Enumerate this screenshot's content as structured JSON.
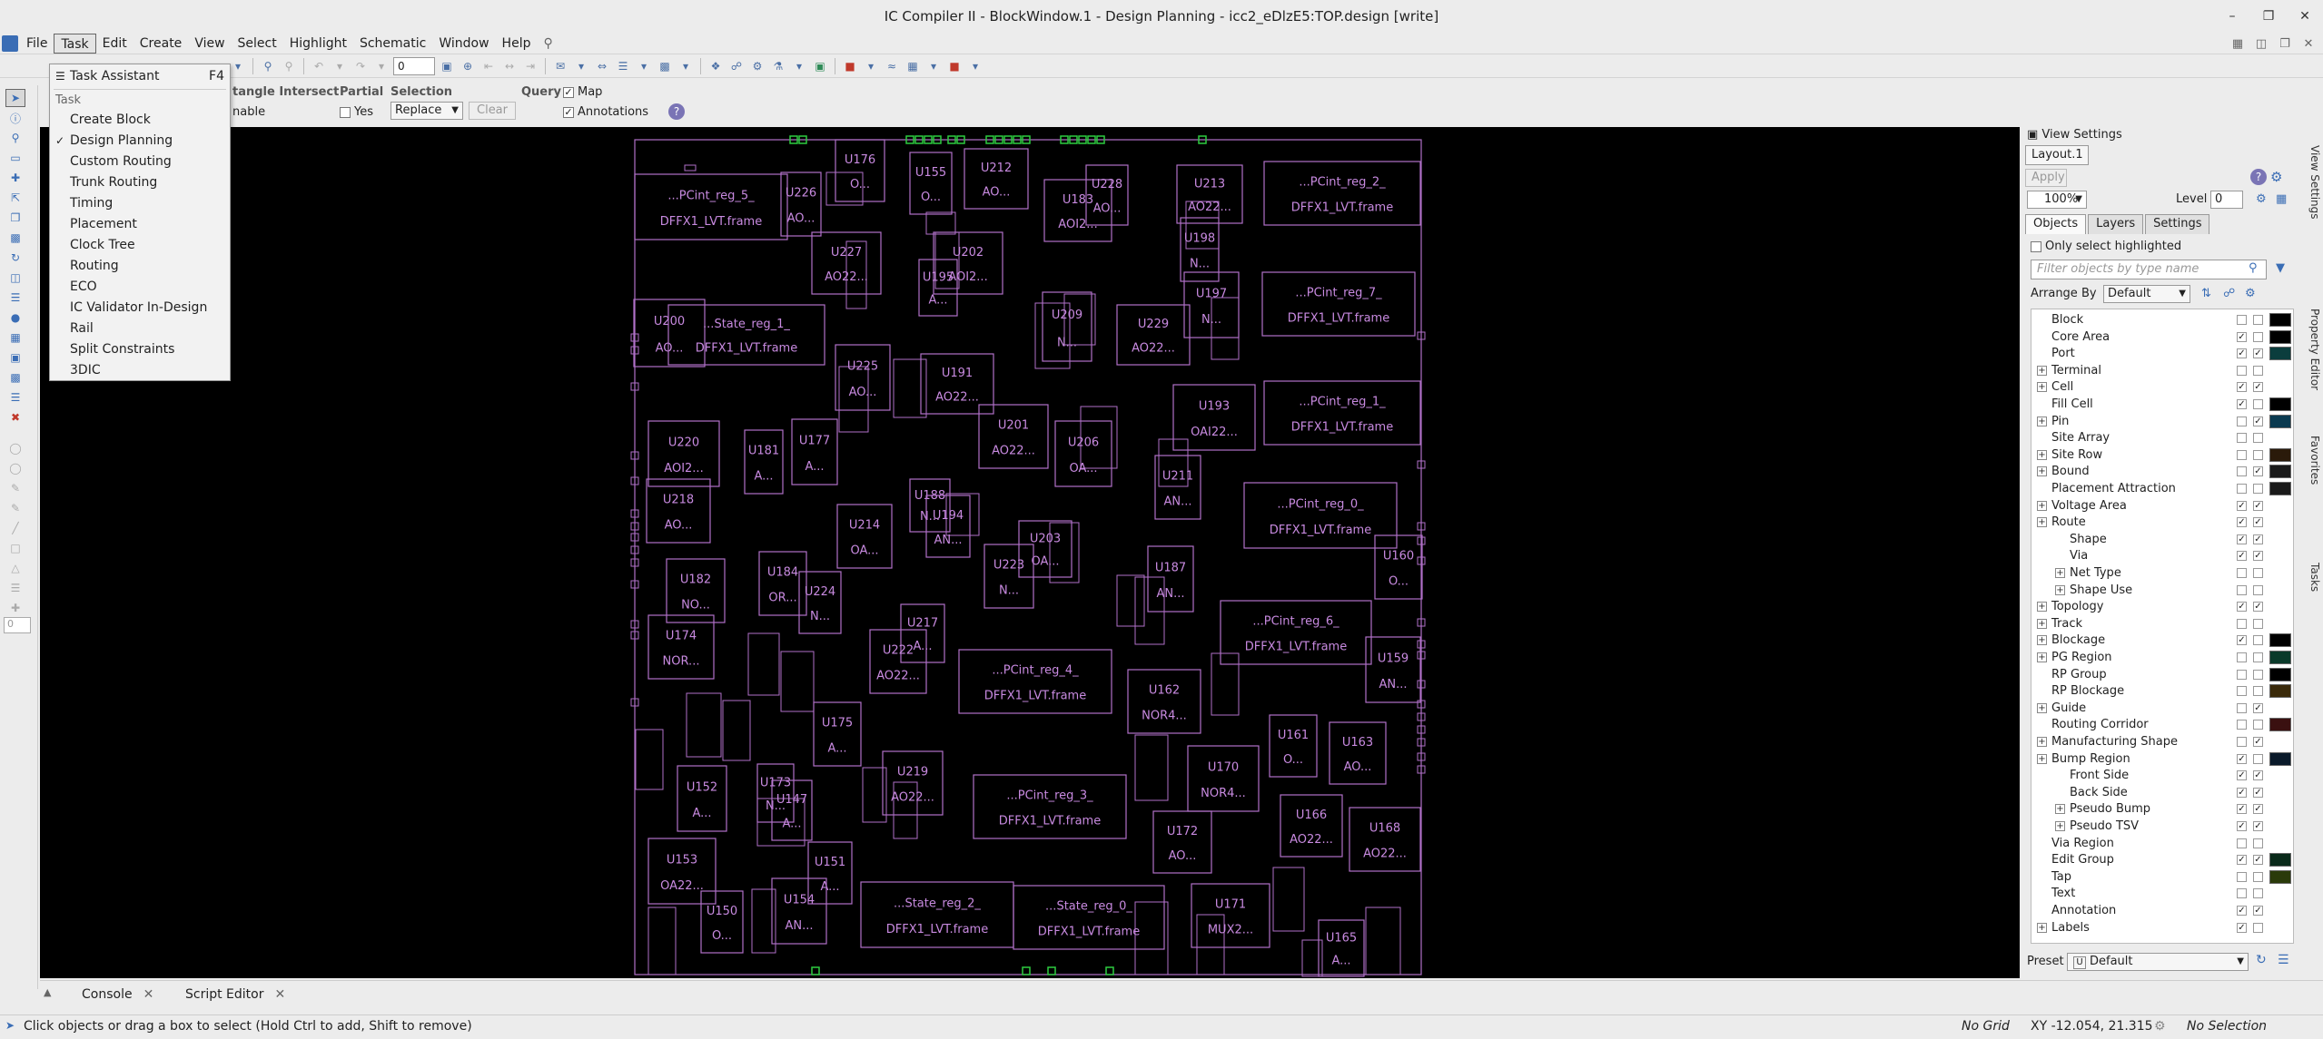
{
  "window": {
    "title": "IC Compiler II - BlockWindow.1 - Design Planning - icc2_eDlzE5:TOP.design [write]",
    "controls": [
      "–",
      "❐",
      "✕"
    ]
  },
  "menubar": {
    "items": [
      "File",
      "Task",
      "Create",
      "Edit",
      "Create",
      "View",
      "Select",
      "Highlight",
      "Schematic",
      "Window",
      "Help"
    ],
    "labels": [
      "File",
      "Task",
      "Edit",
      "Create",
      "View",
      "Select",
      "Highlight",
      "Schematic",
      "Window",
      "Help"
    ]
  },
  "toolbar": {
    "zoom_spin_value": "0"
  },
  "selection_toolbar": {
    "intersect_label": "tangle Intersect",
    "enable_label": "nable",
    "partial_label": "Partial",
    "partial_yes": "Yes",
    "selection_label": "Selection",
    "selection_mode": "Replace",
    "clear_label": "Clear",
    "query_label": "Query",
    "map_label": "Map",
    "annotations_label": "Annotations",
    "help": "?"
  },
  "task_menu": {
    "task_assistant": "Task Assistant",
    "task_assistant_shortcut": "F4",
    "section": "Task",
    "items": [
      "Create Block",
      "Design Planning",
      "Custom Routing",
      "Trunk Routing",
      "Timing",
      "Placement",
      "Clock Tree",
      "Routing",
      "ECO",
      "IC Validator In-Design",
      "Rail",
      "Split Constraints",
      "3DIC"
    ],
    "checked": "Design Planning"
  },
  "left_strip": {
    "value": "0"
  },
  "layout": {
    "cells": [
      {
        "name": "...PCint_reg_5_",
        "ref": "DFFX1_LVT.frame"
      },
      {
        "name": "U226",
        "ref": "AO..."
      },
      {
        "name": "U176",
        "ref": "O..."
      },
      {
        "name": "U155",
        "ref": "O..."
      },
      {
        "name": "U212",
        "ref": "AO..."
      },
      {
        "name": "U183",
        "ref": "AOI2..."
      },
      {
        "name": "U228",
        "ref": "AO..."
      },
      {
        "name": "U213",
        "ref": "AO22..."
      },
      {
        "name": "...PCint_reg_2_",
        "ref": "DFFX1_LVT.frame"
      },
      {
        "name": "U227",
        "ref": "AO22..."
      },
      {
        "name": "U202",
        "ref": "AOI2..."
      },
      {
        "name": "U195",
        "ref": "A..."
      },
      {
        "name": "U198",
        "ref": "N..."
      },
      {
        "name": "U197",
        "ref": "N..."
      },
      {
        "name": "...PCint_reg_7_",
        "ref": "DFFX1_LVT.frame"
      },
      {
        "name": "U200",
        "ref": "AO..."
      },
      {
        "name": "...State_reg_1_",
        "ref": "DFFX1_LVT.frame"
      },
      {
        "name": "U209",
        "ref": "N..."
      },
      {
        "name": "U229",
        "ref": "AO22..."
      },
      {
        "name": "U225",
        "ref": "AO..."
      },
      {
        "name": "U191",
        "ref": "AO22..."
      },
      {
        "name": "U193",
        "ref": "OAI22..."
      },
      {
        "name": "...PCint_reg_1_",
        "ref": "DFFX1_LVT.frame"
      },
      {
        "name": "U220",
        "ref": "AOI2..."
      },
      {
        "name": "U181",
        "ref": "A..."
      },
      {
        "name": "U177",
        "ref": "A..."
      },
      {
        "name": "U201",
        "ref": "AO22..."
      },
      {
        "name": "U206",
        "ref": "OA..."
      },
      {
        "name": "U211",
        "ref": "AN..."
      },
      {
        "name": "U218",
        "ref": "AO..."
      },
      {
        "name": "U188",
        "ref": "N..."
      },
      {
        "name": "U194",
        "ref": "AN..."
      },
      {
        "name": "U214",
        "ref": "OA..."
      },
      {
        "name": "...PCint_reg_0_",
        "ref": "DFFX1_LVT.frame"
      },
      {
        "name": "U203",
        "ref": "OA..."
      },
      {
        "name": "U223",
        "ref": "N..."
      },
      {
        "name": "U160",
        "ref": "O..."
      },
      {
        "name": "U182",
        "ref": "NO..."
      },
      {
        "name": "U184",
        "ref": "OR..."
      },
      {
        "name": "U224",
        "ref": "N..."
      },
      {
        "name": "U187",
        "ref": "AN..."
      },
      {
        "name": "U174",
        "ref": "NOR..."
      },
      {
        "name": "U217",
        "ref": "A..."
      },
      {
        "name": "U222",
        "ref": "AO22..."
      },
      {
        "name": "...PCint_reg_6_",
        "ref": "DFFX1_LVT.frame"
      },
      {
        "name": "...PCint_reg_4_",
        "ref": "DFFX1_LVT.frame"
      },
      {
        "name": "U162",
        "ref": "NOR4..."
      },
      {
        "name": "U159",
        "ref": "AN..."
      },
      {
        "name": "U175",
        "ref": "A..."
      },
      {
        "name": "U161",
        "ref": "O..."
      },
      {
        "name": "U163",
        "ref": "AO..."
      },
      {
        "name": "U152",
        "ref": "A..."
      },
      {
        "name": "U173",
        "ref": "N..."
      },
      {
        "name": "U147",
        "ref": "A..."
      },
      {
        "name": "U219",
        "ref": "AO22..."
      },
      {
        "name": "...PCint_reg_3_",
        "ref": "DFFX1_LVT.frame"
      },
      {
        "name": "U170",
        "ref": "NOR4..."
      },
      {
        "name": "U166",
        "ref": "AO22..."
      },
      {
        "name": "U168",
        "ref": "AO22..."
      },
      {
        "name": "U153",
        "ref": "OA22..."
      },
      {
        "name": "U151",
        "ref": "A..."
      },
      {
        "name": "U172",
        "ref": "AO..."
      },
      {
        "name": "U150",
        "ref": "O..."
      },
      {
        "name": "U154",
        "ref": "AN..."
      },
      {
        "name": "...State_reg_2_",
        "ref": "DFFX1_LVT.frame"
      },
      {
        "name": "...State_reg_0_",
        "ref": "DFFX1_LVT.frame"
      },
      {
        "name": "U171",
        "ref": "MUX2..."
      },
      {
        "name": "U165",
        "ref": "A..."
      }
    ]
  },
  "view_settings": {
    "header": "View Settings",
    "layout_tab": "Layout.1",
    "apply": "Apply",
    "zoom": "100%",
    "level_label": "Level",
    "level_value": "0",
    "tabs": [
      "Objects",
      "Layers",
      "Settings"
    ],
    "only_select_highlighted": "Only select highlighted",
    "filter_placeholder": "Filter objects by type name",
    "arrange_by_label": "Arrange By",
    "arrange_by_value": "Default",
    "tree": [
      {
        "label": "Block",
        "indent": 0,
        "exp": false
      },
      {
        "label": "Core Area",
        "indent": 0,
        "exp": false
      },
      {
        "label": "Port",
        "indent": 0,
        "exp": false
      },
      {
        "label": "Terminal",
        "indent": 0,
        "exp": true
      },
      {
        "label": "Cell",
        "indent": 0,
        "exp": true
      },
      {
        "label": "Fill Cell",
        "indent": 0,
        "exp": false
      },
      {
        "label": "Pin",
        "indent": 0,
        "exp": true
      },
      {
        "label": "Site Array",
        "indent": 0,
        "exp": false
      },
      {
        "label": "Site Row",
        "indent": 0,
        "exp": true
      },
      {
        "label": "Bound",
        "indent": 0,
        "exp": true
      },
      {
        "label": "Placement Attraction",
        "indent": 0,
        "exp": false
      },
      {
        "label": "Voltage Area",
        "indent": 0,
        "exp": true
      },
      {
        "label": "Route",
        "indent": 0,
        "exp": true
      },
      {
        "label": "Shape",
        "indent": 1,
        "exp": false
      },
      {
        "label": "Via",
        "indent": 1,
        "exp": false
      },
      {
        "label": "Net Type",
        "indent": 1,
        "exp": true
      },
      {
        "label": "Shape Use",
        "indent": 1,
        "exp": true
      },
      {
        "label": "Topology",
        "indent": 0,
        "exp": true
      },
      {
        "label": "Track",
        "indent": 0,
        "exp": true
      },
      {
        "label": "Blockage",
        "indent": 0,
        "exp": true
      },
      {
        "label": "PG Region",
        "indent": 0,
        "exp": true
      },
      {
        "label": "RP Group",
        "indent": 0,
        "exp": false
      },
      {
        "label": "RP Blockage",
        "indent": 0,
        "exp": false
      },
      {
        "label": "Guide",
        "indent": 0,
        "exp": true
      },
      {
        "label": "Routing Corridor",
        "indent": 0,
        "exp": false
      },
      {
        "label": "Manufacturing Shape",
        "indent": 0,
        "exp": true
      },
      {
        "label": "Bump Region",
        "indent": 0,
        "exp": true
      },
      {
        "label": "Front Side",
        "indent": 1,
        "exp": false
      },
      {
        "label": "Back Side",
        "indent": 1,
        "exp": false
      },
      {
        "label": "Pseudo Bump",
        "indent": 1,
        "exp": true
      },
      {
        "label": "Pseudo TSV",
        "indent": 1,
        "exp": true
      },
      {
        "label": "Via Region",
        "indent": 0,
        "exp": false
      },
      {
        "label": "Edit Group",
        "indent": 0,
        "exp": false
      },
      {
        "label": "Tap",
        "indent": 0,
        "exp": false
      },
      {
        "label": "Text",
        "indent": 0,
        "exp": false
      },
      {
        "label": "Annotation",
        "indent": 0,
        "exp": false
      },
      {
        "label": "Labels",
        "indent": 0,
        "exp": true
      }
    ],
    "preset_label": "Preset",
    "preset_value": "Default"
  },
  "side_tabs": [
    "View Settings",
    "Property Editor",
    "Favorites",
    "Tasks"
  ],
  "bottom_tabs": [
    "Console",
    "Script Editor"
  ],
  "status": {
    "message": "Click objects or drag a box to select (Hold Ctrl to add, Shift to remove)",
    "grid": "No Grid",
    "xy": "XY -12.054, 21.315",
    "selection": "No Selection"
  },
  "colors": {
    "cell_outline": "#b070c8",
    "cell_text": "#c88ae0",
    "terminal": "#2ecc40",
    "canvas": "#000000"
  }
}
